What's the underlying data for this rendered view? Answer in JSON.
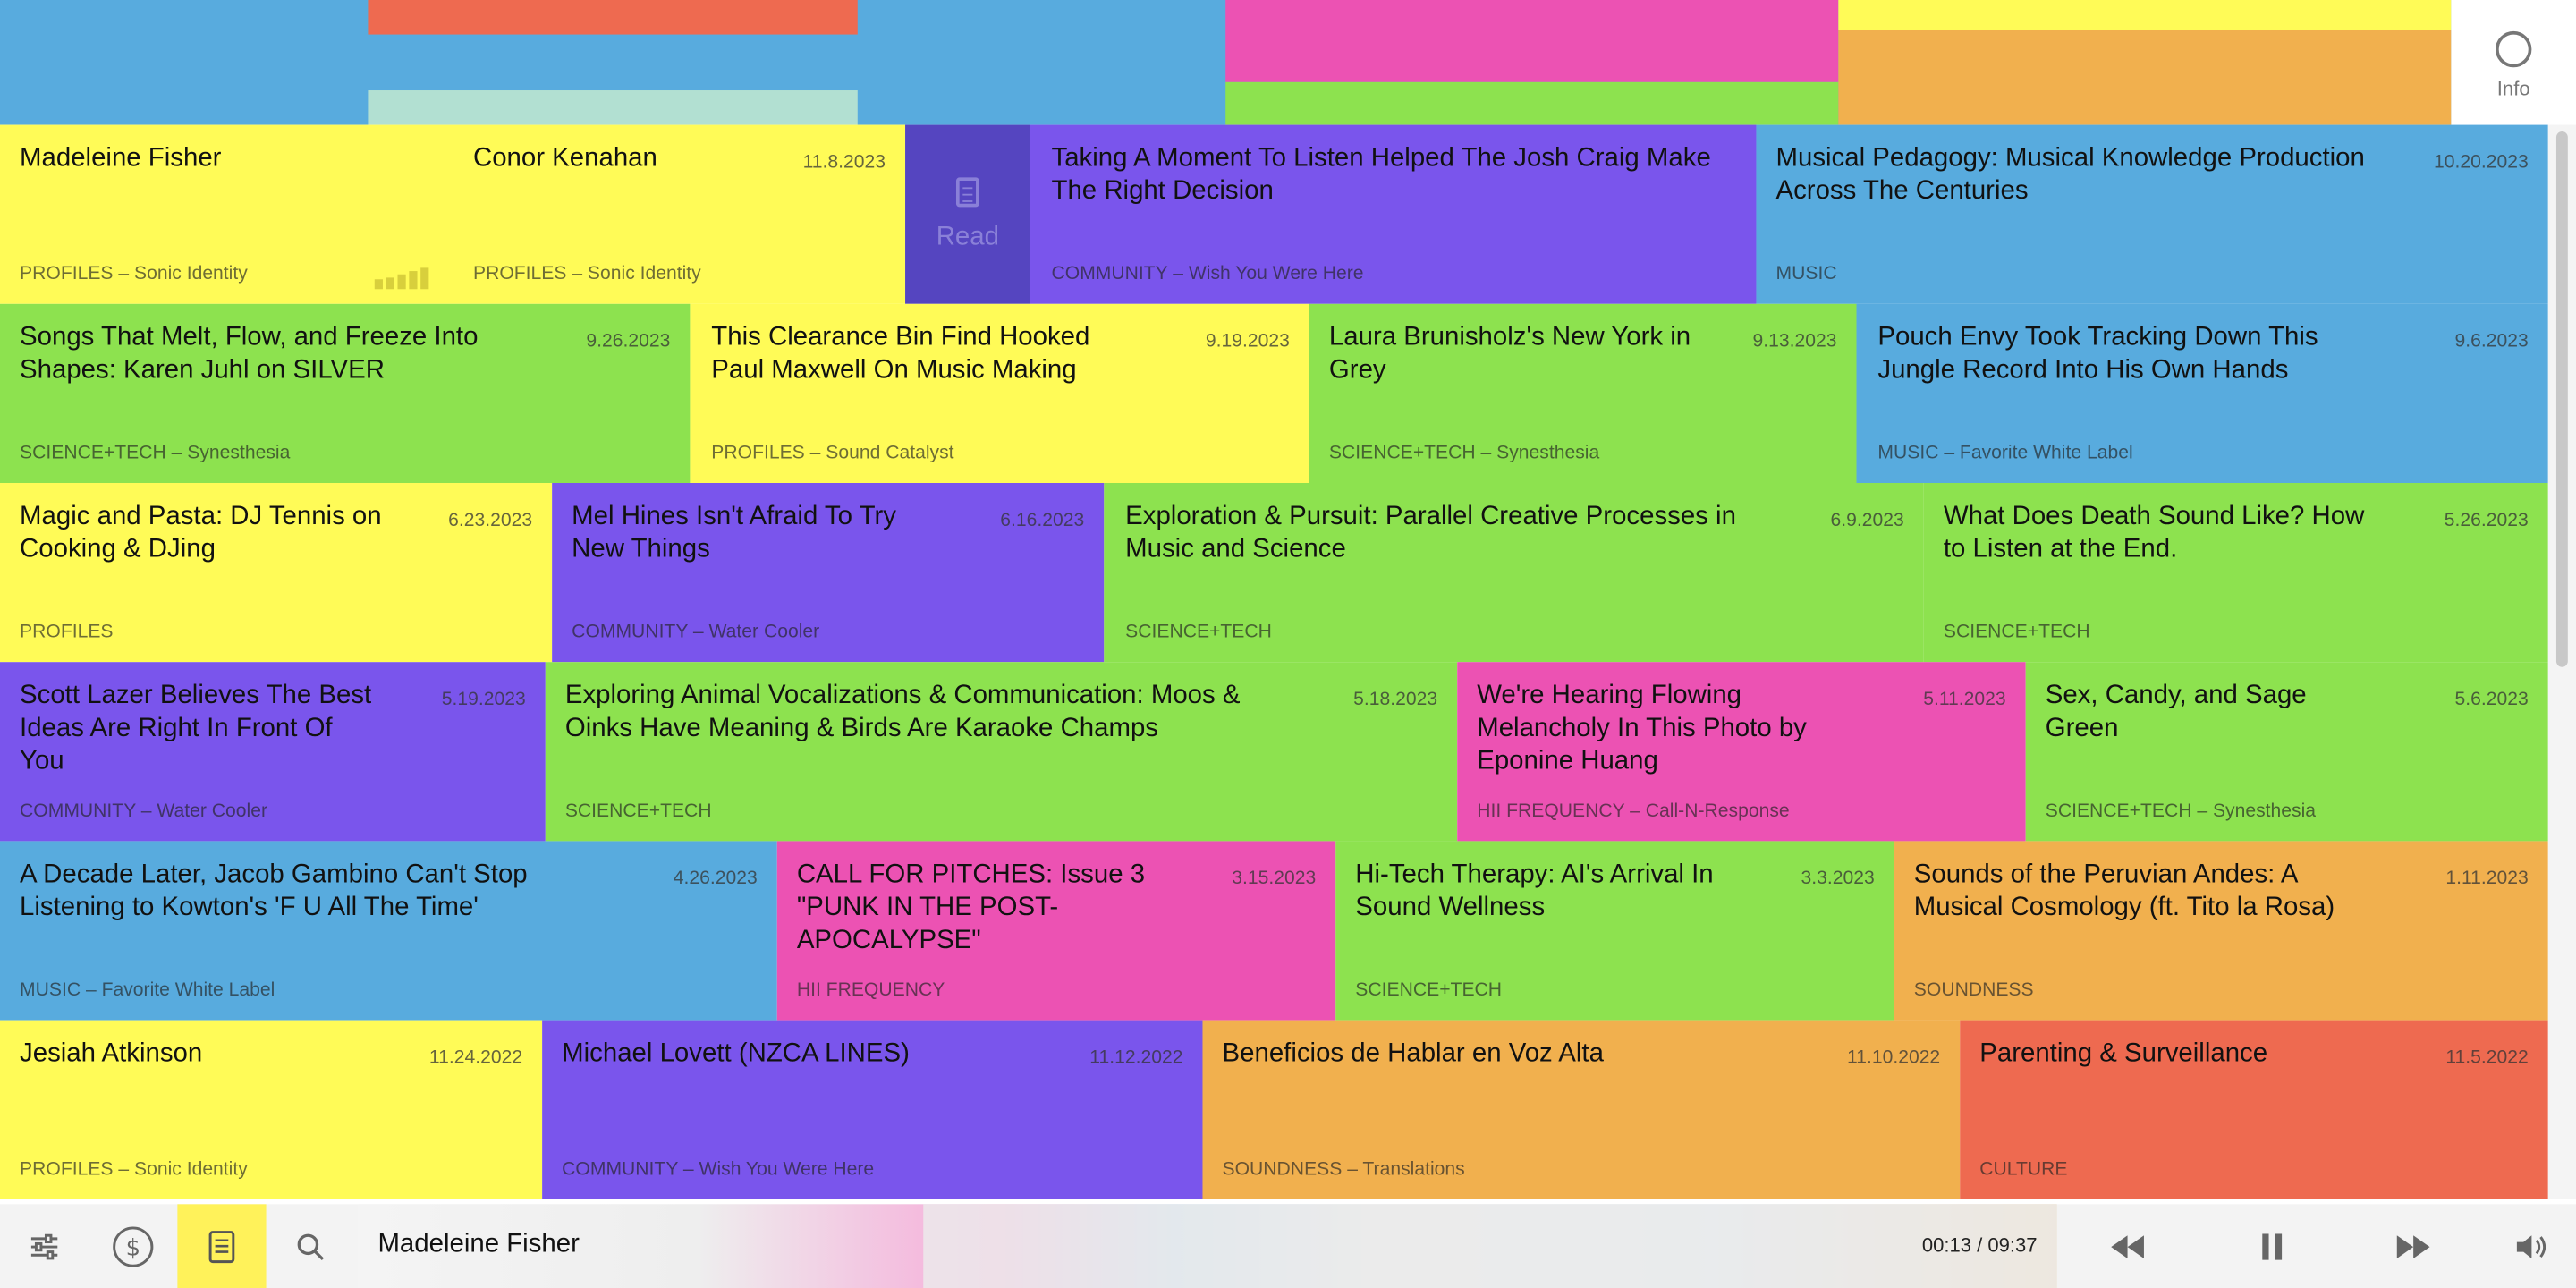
{
  "info": {
    "label": "Info"
  },
  "read_tile": {
    "label": "Read"
  },
  "rows": [
    [
      {
        "title": "Madeleine Fisher",
        "date": "",
        "category": "PROFILES – Sonic Identity",
        "color": "#fffb57"
      },
      {
        "title": "Conor Kenahan",
        "date": "11.8.2023",
        "category": "PROFILES – Sonic Identity",
        "color": "#fffb57"
      },
      {
        "title": "Taking A Moment To Listen Helped The Josh Craig Make The Right Decision",
        "date": "",
        "category": "COMMUNITY – Wish You Were Here",
        "color": "#7a55ec"
      },
      {
        "title": "Musical Pedagogy: Musical Knowledge Production Across The Centuries",
        "date": "10.20.2023",
        "category": "MUSIC",
        "color": "#58abde"
      }
    ],
    [
      {
        "title": "Songs That Melt, Flow, and Freeze Into Shapes: Karen Juhl on SILVER",
        "date": "9.26.2023",
        "category": "SCIENCE+TECH – Synesthesia",
        "color": "#8de24f"
      },
      {
        "title": "This Clearance Bin Find Hooked Paul Maxwell On Music Making",
        "date": "9.19.2023",
        "category": "PROFILES – Sound Catalyst",
        "color": "#fffb57"
      },
      {
        "title": "Laura Brunisholz's New York in Grey",
        "date": "9.13.2023",
        "category": "SCIENCE+TECH – Synesthesia",
        "color": "#8de24f"
      },
      {
        "title": "Pouch Envy Took Tracking Down This Jungle Record Into His Own Hands",
        "date": "9.6.2023",
        "category": "MUSIC – Favorite White Label",
        "color": "#58abde"
      }
    ],
    [
      {
        "title": "Magic and Pasta: DJ Tennis on Cooking & DJing",
        "date": "6.23.2023",
        "category": "PROFILES",
        "color": "#fffb57"
      },
      {
        "title": "Mel Hines Isn't Afraid To Try New Things",
        "date": "6.16.2023",
        "category": "COMMUNITY – Water Cooler",
        "color": "#7a55ec"
      },
      {
        "title": "Exploration & Pursuit: Parallel Creative Processes in Music and Science",
        "date": "6.9.2023",
        "category": "SCIENCE+TECH",
        "color": "#8de24f"
      },
      {
        "title": "What Does Death Sound Like? How to Listen at the End.",
        "date": "5.26.2023",
        "category": "SCIENCE+TECH",
        "color": "#8de24f"
      }
    ],
    [
      {
        "title": "Scott Lazer Believes The Best Ideas Are Right In Front Of You",
        "date": "5.19.2023",
        "category": "COMMUNITY – Water Cooler",
        "color": "#7a55ec"
      },
      {
        "title": "Exploring Animal Vocalizations & Communication: Moos & Oinks Have Meaning & Birds Are Karaoke Champs",
        "date": "5.18.2023",
        "category": "SCIENCE+TECH",
        "color": "#8de24f"
      },
      {
        "title": "We're Hearing Flowing Melancholy In This Photo by Eponine Huang",
        "date": "5.11.2023",
        "category": "HII FREQUENCY – Call-N-Response",
        "color": "#ec52b3"
      },
      {
        "title": "Sex, Candy, and Sage Green",
        "date": "5.6.2023",
        "category": "SCIENCE+TECH – Synesthesia",
        "color": "#8de24f"
      }
    ],
    [
      {
        "title": "A Decade Later, Jacob Gambino Can't Stop Listening to Kowton's 'F U All The Time'",
        "date": "4.26.2023",
        "category": "MUSIC – Favorite White Label",
        "color": "#58abde"
      },
      {
        "title": "CALL FOR PITCHES: Issue 3 \"PUNK IN THE POST-APOCALYPSE\"",
        "date": "3.15.2023",
        "category": "HII FREQUENCY",
        "color": "#ec52b3"
      },
      {
        "title": "Hi-Tech Therapy: AI's Arrival In Sound Wellness",
        "date": "3.3.2023",
        "category": "SCIENCE+TECH",
        "color": "#8de24f"
      },
      {
        "title": "Sounds of the Peruvian Andes: A Musical Cosmology (ft. Tito la Rosa)",
        "date": "1.11.2023",
        "category": "SOUNDNESS",
        "color": "#f1b04e"
      }
    ],
    [
      {
        "title": "Jesiah Atkinson",
        "date": "11.24.2022",
        "category": "PROFILES – Sonic Identity",
        "color": "#fffb57"
      },
      {
        "title": "Michael Lovett (NZCA LINES)",
        "date": "11.12.2022",
        "category": "COMMUNITY – Wish You Were Here",
        "color": "#7a55ec"
      },
      {
        "title": "Beneficios de Hablar en Voz Alta",
        "date": "11.10.2022",
        "category": "SOUNDNESS – Translations",
        "color": "#f1b04e"
      },
      {
        "title": "Parenting & Surveillance",
        "date": "11.5.2022",
        "category": "CULTURE",
        "color": "#ee6a50"
      }
    ]
  ],
  "player": {
    "track": "Madeleine Fisher",
    "time": "00:13 / 09:37",
    "progress": 0.0225,
    "buttons": [
      "settings-icon",
      "dollar-icon",
      "document-icon",
      "search-icon"
    ],
    "controls": [
      "rewind-icon",
      "pause-icon",
      "fast-forward-icon",
      "volume-icon"
    ]
  }
}
